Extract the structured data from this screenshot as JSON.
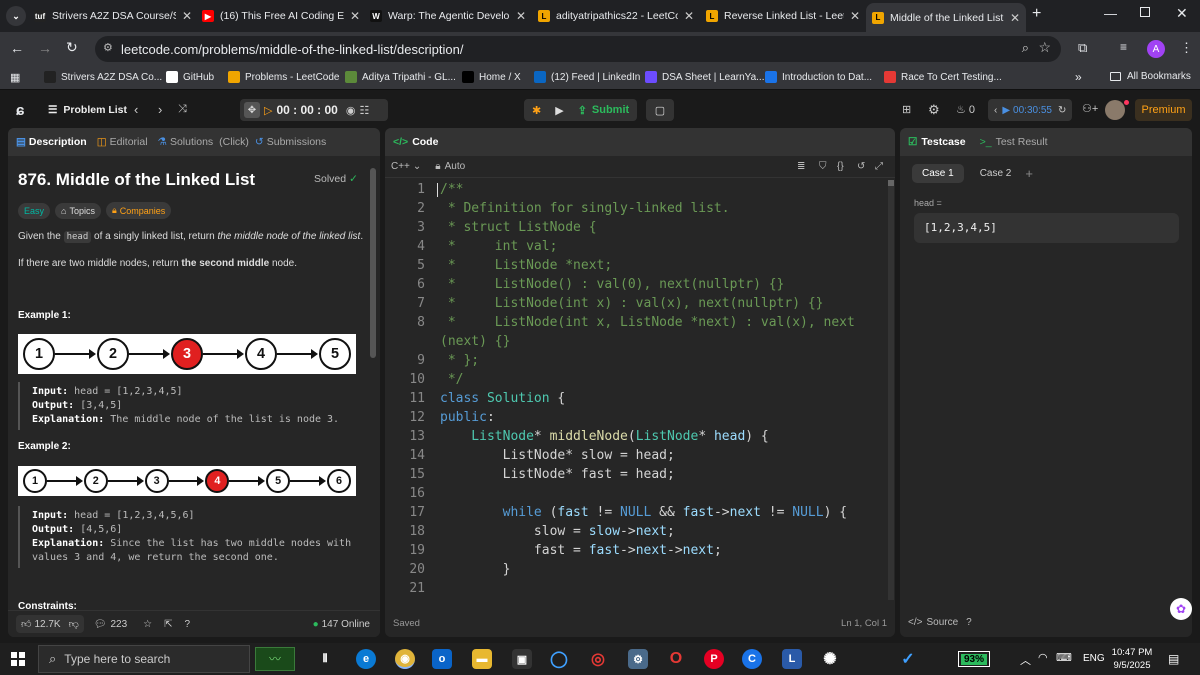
{
  "browser": {
    "tabs": [
      {
        "title": "Strivers A2Z DSA Course/S",
        "color": "#222",
        "glyph": "tuf"
      },
      {
        "title": "(16) This Free AI Coding Er",
        "color": "#ff0000",
        "glyph": "▶"
      },
      {
        "title": "Warp: The Agentic Develop",
        "color": "#111",
        "glyph": "W"
      },
      {
        "title": "adityatripathics22 - LeetCo",
        "color": "#f0a500",
        "glyph": "L"
      },
      {
        "title": "Reverse Linked List - LeetC",
        "color": "#f0a500",
        "glyph": "L"
      },
      {
        "title": "Middle of the Linked List -",
        "color": "#f0a500",
        "glyph": "L"
      }
    ],
    "url": "leetcode.com/problems/middle-of-the-linked-list/description/",
    "profile_initial": "A",
    "bookmarks": [
      {
        "label": "Strivers A2Z DSA Co...",
        "color": "#222"
      },
      {
        "label": "GitHub",
        "color": "#fff"
      },
      {
        "label": "Problems - LeetCode",
        "color": "#f0a500"
      },
      {
        "label": "Aditya Tripathi - GL...",
        "color": "#5c8a3a"
      },
      {
        "label": "Home / X",
        "color": "#000"
      },
      {
        "label": "(12) Feed | LinkedIn",
        "color": "#0a66c2"
      },
      {
        "label": "DSA Sheet | LearnYa...",
        "color": "#6c4cff"
      },
      {
        "label": "Introduction to Dat...",
        "color": "#1a73e8"
      },
      {
        "label": "Race To Cert Testing...",
        "color": "#e53935"
      }
    ],
    "bookmarks_more": "»",
    "all_bookmarks": "All Bookmarks"
  },
  "lc": {
    "problem_list": "Problem List",
    "timer": "00 : 00 : 00",
    "submit": "Submit",
    "streak": "0",
    "session_timer": "00:30:55",
    "premium": "Premium"
  },
  "left": {
    "tabs": [
      "Description",
      "Editorial",
      "Solutions",
      "(Click)",
      "Submissions"
    ],
    "title": "876. Middle of the Linked List",
    "solved": "Solved",
    "tags": [
      "Easy",
      "Topics",
      "Companies"
    ],
    "desc1_pre": "Given the ",
    "desc1_code": "head",
    "desc1_mid": " of a singly linked list, return ",
    "desc1_em": "the middle node of the linked list",
    "desc1_post": ".",
    "desc2_pre": "If there are two middle nodes, return ",
    "desc2_b": "the second middle",
    "desc2_post": " node.",
    "ex1_title": "Example 1:",
    "ex1_nodes": [
      "1",
      "2",
      "3",
      "4",
      "5"
    ],
    "ex1_input_k": "Input:",
    "ex1_input_v": "head = [1,2,3,4,5]",
    "ex1_output_k": "Output:",
    "ex1_output_v": "[3,4,5]",
    "ex1_expl_k": "Explanation:",
    "ex1_expl_v": "The middle node of the list is node 3.",
    "ex2_title": "Example 2:",
    "ex2_nodes": [
      "1",
      "2",
      "3",
      "4",
      "5",
      "6"
    ],
    "ex2_input_k": "Input:",
    "ex2_input_v": "head = [1,2,3,4,5,6]",
    "ex2_output_k": "Output:",
    "ex2_output_v": "[4,5,6]",
    "ex2_expl_k": "Explanation:",
    "ex2_expl_v1": "Since the list has two middle nodes with",
    "ex2_expl_v2": "values 3 and 4, we return the second one.",
    "constraints": "Constraints:",
    "likes": "12.7K",
    "comments": "223",
    "online": "147 Online"
  },
  "code": {
    "header": "Code",
    "lang": "C++",
    "mode": "Auto",
    "saved": "Saved",
    "cursor": "Ln 1, Col 1",
    "lines": [
      {
        "n": "1",
        "segs": [
          [
            "cm",
            "/**"
          ]
        ]
      },
      {
        "n": "2",
        "segs": [
          [
            "cm",
            " * Definition for singly-linked list."
          ]
        ]
      },
      {
        "n": "3",
        "segs": [
          [
            "cm",
            " * struct ListNode {"
          ]
        ]
      },
      {
        "n": "4",
        "segs": [
          [
            "cm",
            " *     int val;"
          ]
        ]
      },
      {
        "n": "5",
        "segs": [
          [
            "cm",
            " *     ListNode *next;"
          ]
        ]
      },
      {
        "n": "6",
        "segs": [
          [
            "cm",
            " *     ListNode() : val(0), next(nullptr) {}"
          ]
        ]
      },
      {
        "n": "7",
        "segs": [
          [
            "cm",
            " *     ListNode(int x) : val(x), next(nullptr) {}"
          ]
        ]
      },
      {
        "n": "8",
        "segs": [
          [
            "cm",
            " *     ListNode(int x, ListNode *next) : val(x), next"
          ]
        ]
      },
      {
        "n": "",
        "segs": [
          [
            "cm",
            "(next) {}"
          ]
        ]
      },
      {
        "n": "9",
        "segs": [
          [
            "cm",
            " * };"
          ]
        ]
      },
      {
        "n": "10",
        "segs": [
          [
            "cm",
            " */"
          ]
        ]
      },
      {
        "n": "11",
        "segs": [
          [
            "kw",
            "class "
          ],
          [
            "ty",
            "Solution"
          ],
          [
            "tx",
            " {"
          ]
        ]
      },
      {
        "n": "12",
        "segs": [
          [
            "kw",
            "public"
          ],
          [
            "tx",
            ":"
          ]
        ]
      },
      {
        "n": "13",
        "segs": [
          [
            "ty",
            "    ListNode"
          ],
          [
            "tx",
            "* "
          ],
          [
            "fn",
            "middleNode"
          ],
          [
            "tx",
            "("
          ],
          [
            "ty",
            "ListNode"
          ],
          [
            "tx",
            "* "
          ],
          [
            "pm",
            "head"
          ],
          [
            "tx",
            ") {"
          ]
        ]
      },
      {
        "n": "14",
        "segs": [
          [
            "tx",
            "        ListNode* slow = head;"
          ]
        ]
      },
      {
        "n": "15",
        "segs": [
          [
            "tx",
            "        ListNode* fast = head;"
          ]
        ]
      },
      {
        "n": "16",
        "segs": [
          [
            "tx",
            ""
          ]
        ]
      },
      {
        "n": "17",
        "segs": [
          [
            "kw",
            "        while"
          ],
          [
            "tx",
            " ("
          ],
          [
            "pm",
            "fast"
          ],
          [
            "tx",
            " != "
          ],
          [
            "kw",
            "NULL"
          ],
          [
            "tx",
            " && "
          ],
          [
            "pm",
            "fast"
          ],
          [
            "tx",
            "->"
          ],
          [
            "pm",
            "next"
          ],
          [
            "tx",
            " != "
          ],
          [
            "kw",
            "NULL"
          ],
          [
            "tx",
            ") {"
          ]
        ]
      },
      {
        "n": "18",
        "segs": [
          [
            "tx",
            "            slow = "
          ],
          [
            "pm",
            "slow"
          ],
          [
            "tx",
            "->"
          ],
          [
            "pm",
            "next"
          ],
          [
            "tx",
            ";"
          ]
        ]
      },
      {
        "n": "19",
        "segs": [
          [
            "tx",
            "            fast = "
          ],
          [
            "pm",
            "fast"
          ],
          [
            "tx",
            "->"
          ],
          [
            "pm",
            "next"
          ],
          [
            "tx",
            "->"
          ],
          [
            "pm",
            "next"
          ],
          [
            "tx",
            ";"
          ]
        ]
      },
      {
        "n": "20",
        "segs": [
          [
            "tx",
            "        }"
          ]
        ]
      },
      {
        "n": "21",
        "segs": [
          [
            "tx",
            ""
          ]
        ]
      }
    ]
  },
  "testcase": {
    "tab1": "Testcase",
    "tab2": "Test Result",
    "case1": "Case 1",
    "case2": "Case 2",
    "add": "+",
    "label": "head =",
    "value": "[1,2,3,4,5]",
    "source": "Source"
  },
  "taskbar": {
    "search": "Type here to search",
    "battery": "93%",
    "lang": "ENG",
    "time": "10:47 PM",
    "date": "9/5/2025"
  }
}
